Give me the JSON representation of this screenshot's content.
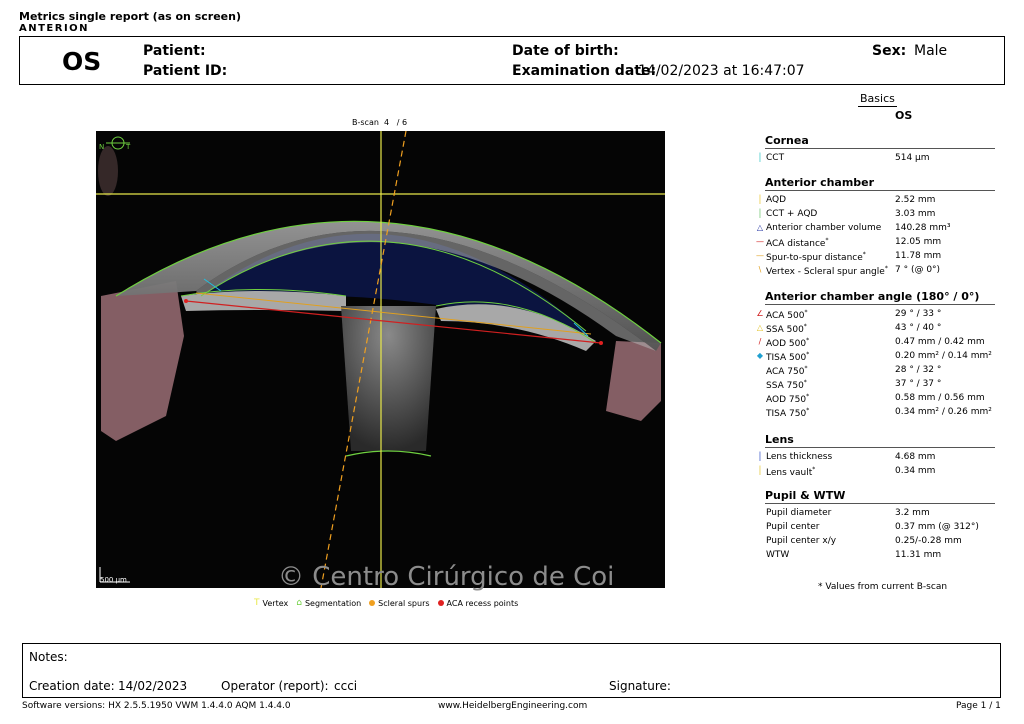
{
  "report": {
    "title": "Metrics single report (as on screen)",
    "brand": "ANTERION"
  },
  "header": {
    "eye": "OS",
    "patient_label": "Patient:",
    "patient_value": "",
    "patient_id_label": "Patient ID:",
    "patient_id_value": "",
    "dob_label": "Date of birth:",
    "dob_value": "",
    "exam_label": "Examination date:",
    "exam_value": "14/02/2023 at 16:47:07",
    "sex_label": "Sex:",
    "sex_value": "Male"
  },
  "tabs": {
    "basics": "Basics",
    "eye": "OS"
  },
  "scan": {
    "bscan_label": "B-scan",
    "bscan_index": "4",
    "bscan_total": "/ 6",
    "orientation_n": "N",
    "orientation_t": "T",
    "scale_label": "500 µm",
    "watermark": "© Centro Cirúrgico de Coi"
  },
  "legend": [
    {
      "label": "Vertex",
      "color": "#e8e84a",
      "icon": "vertex-icon"
    },
    {
      "label": "Segmentation",
      "color": "#6fd040",
      "icon": "segmentation-icon"
    },
    {
      "label": "Scleral spurs",
      "color": "#f0a020",
      "icon": "scleral-spur-icon"
    },
    {
      "label": "ACA recess points",
      "color": "#e02020",
      "icon": "aca-recess-icon"
    }
  ],
  "sections": {
    "cornea": {
      "title": "Cornea",
      "rows": [
        {
          "label": "CCT",
          "value": "514 µm",
          "icon": "cct-icon",
          "color": "#20c0c0"
        }
      ]
    },
    "anterior_chamber": {
      "title": "Anterior chamber",
      "rows": [
        {
          "label": "AQD",
          "value": "2.52 mm",
          "icon": "aqd-icon",
          "color": "#e8c020"
        },
        {
          "label": "CCT + AQD",
          "value": "3.03 mm",
          "icon": "cct-aqd-icon",
          "color": "#60c060"
        },
        {
          "label": "Anterior chamber volume",
          "value": "140.28 mm³",
          "icon": "chamber-volume-icon",
          "color": "#2030a0"
        },
        {
          "label": "ACA distance",
          "value": "12.05 mm",
          "icon": "aca-distance-icon",
          "color": "#d02020"
        },
        {
          "label": "Spur-to-spur distance",
          "value": "11.78 mm",
          "icon": "spur-distance-icon",
          "color": "#e0a020"
        },
        {
          "label": "Vertex - Scleral spur angle",
          "value": "7 ° (@ 0°)",
          "icon": "vertex-angle-icon",
          "color": "#e0a020"
        }
      ]
    },
    "angle": {
      "title": "Anterior chamber angle (180° / 0°)",
      "rows": [
        {
          "label": "ACA 500",
          "value": "29 ° / 33 °",
          "icon": "aca500-icon",
          "color": "#d02020"
        },
        {
          "label": "SSA 500",
          "value": "43 ° / 40 °",
          "icon": "ssa500-icon",
          "color": "#e0c020"
        },
        {
          "label": "AOD 500",
          "value": "0.47 mm / 0.42 mm",
          "icon": "aod500-icon",
          "color": "#d02020"
        },
        {
          "label": "TISA 500",
          "value": "0.20 mm² / 0.14 mm²",
          "icon": "tisa500-icon",
          "color": "#20a0d0"
        },
        {
          "label": "ACA 750",
          "value": "28 ° / 32 °",
          "icon": "",
          "color": ""
        },
        {
          "label": "SSA 750",
          "value": "37 ° / 37 °",
          "icon": "",
          "color": ""
        },
        {
          "label": "AOD 750",
          "value": "0.58 mm / 0.56 mm",
          "icon": "",
          "color": ""
        },
        {
          "label": "TISA 750",
          "value": "0.34 mm² / 0.26 mm²",
          "icon": "",
          "color": ""
        }
      ]
    },
    "lens": {
      "title": "Lens",
      "rows": [
        {
          "label": "Lens thickness",
          "value": "4.68 mm",
          "icon": "lens-thickness-icon",
          "color": "#2040c0"
        },
        {
          "label": "Lens vault",
          "value": "0.34 mm",
          "icon": "lens-vault-icon",
          "color": "#e0c020"
        }
      ]
    },
    "pupil": {
      "title": "Pupil & WTW",
      "rows": [
        {
          "label": "Pupil diameter",
          "value": "3.2 mm",
          "icon": "",
          "color": ""
        },
        {
          "label": "Pupil center",
          "value": "0.37 mm (@ 312°)",
          "icon": "",
          "color": ""
        },
        {
          "label": "Pupil center x/y",
          "value": "0.25/-0.28 mm",
          "icon": "",
          "color": ""
        },
        {
          "label": "WTW",
          "value": "11.31 mm",
          "icon": "",
          "color": ""
        }
      ]
    }
  },
  "footnote": "* Values from current B-scan",
  "notes": {
    "notes_label": "Notes:",
    "creation_label": "Creation date:",
    "creation_value": "14/02/2023",
    "operator_label": "Operator (report):",
    "operator_value": "ccci",
    "signature_label": "Signature:"
  },
  "footer": {
    "software": "Software versions:  HX 2.5.5.1950 VWM 1.4.4.0  AQM 1.4.4.0",
    "website": "www.HeidelbergEngineering.com",
    "page": "Page  1 / 1"
  }
}
